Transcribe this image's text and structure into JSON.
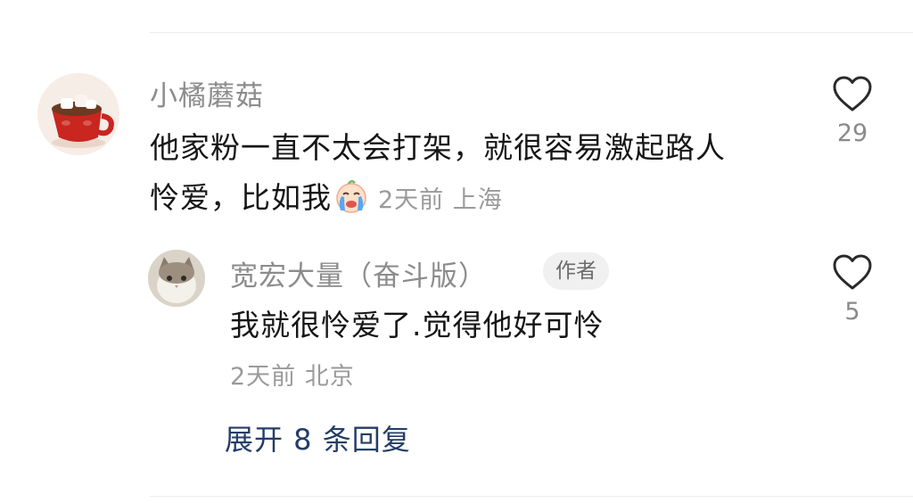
{
  "comment": {
    "username": "小橘蘑菇",
    "text_line1": "他家粉一直不太会打架，就很容易激起路人",
    "text_line2": "怜爱，比如我",
    "emoji": "crying-face-emoji",
    "meta": "2天前 上海",
    "likes": "29"
  },
  "reply": {
    "username": "宽宏大量（奋斗版）",
    "author_tag": "作者",
    "text": "我就很怜爱了.觉得他好可怜",
    "meta": "2天前 北京",
    "likes": "5"
  },
  "expand_replies": "展开 8 条回复",
  "icons": [
    "heart-icon",
    "crying-face-emoji"
  ],
  "colors": {
    "link": "#243d68",
    "secondary_text": "#8c8c8c",
    "divider": "#ececec"
  }
}
